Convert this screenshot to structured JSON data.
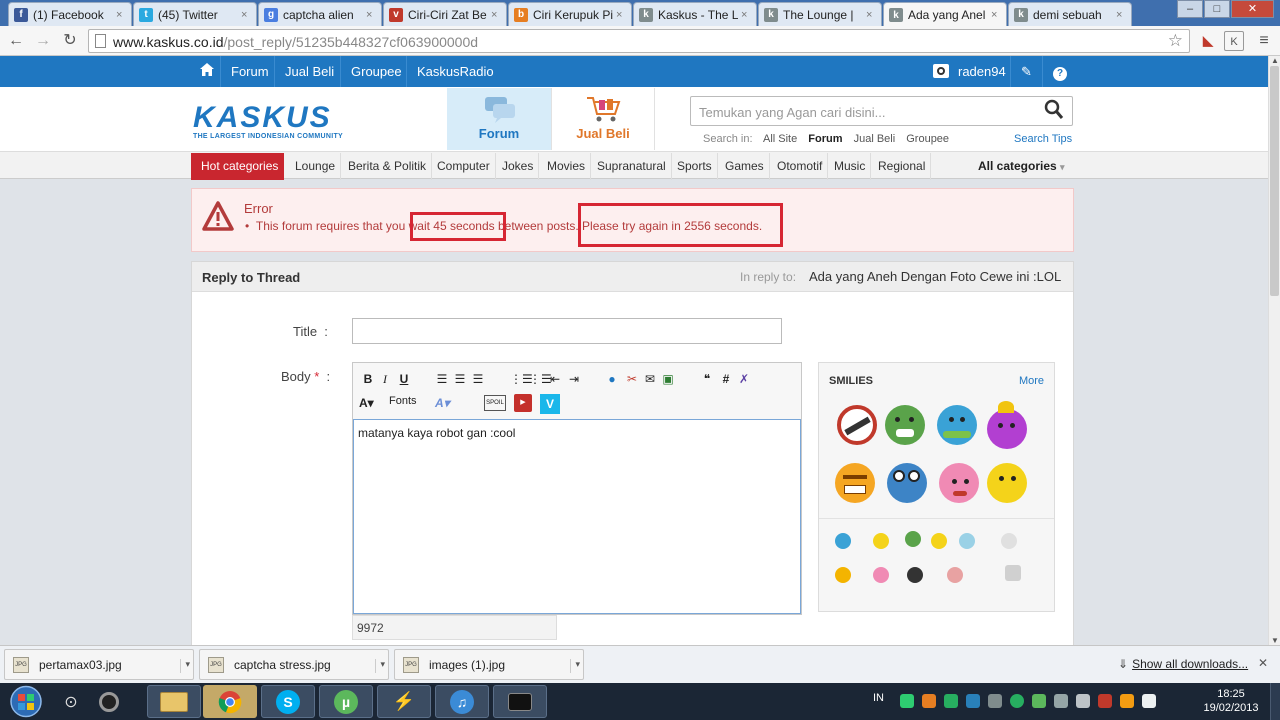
{
  "browser": {
    "tabs": [
      {
        "label": "(1) Facebook",
        "icon": "facebook-icon",
        "color": "#3b5998",
        "glyph": "f"
      },
      {
        "label": "(45) Twitter",
        "icon": "twitter-icon",
        "color": "#2aa9e0",
        "glyph": "t"
      },
      {
        "label": "captcha alien",
        "icon": "google-icon",
        "color": "#4a7ee0",
        "glyph": "g"
      },
      {
        "label": "Ciri-Ciri Zat Be",
        "icon": "shield-icon",
        "color": "#c0392b",
        "glyph": "v"
      },
      {
        "label": "Ciri Kerupuk Pi",
        "icon": "blog-icon",
        "color": "#e67e22",
        "glyph": "b"
      },
      {
        "label": "Kaskus - The L",
        "icon": "kaskus-icon",
        "color": "#7f8c8d",
        "glyph": "k"
      },
      {
        "label": "The Lounge |",
        "icon": "kaskus-icon",
        "color": "#7f8c8d",
        "glyph": "k"
      },
      {
        "label": "Ada yang Anel",
        "icon": "kaskus-icon",
        "color": "#7f8c8d",
        "glyph": "k",
        "active": true
      },
      {
        "label": "demi sebuah",
        "icon": "kaskus-icon",
        "color": "#7f8c8d",
        "glyph": "k"
      }
    ],
    "url_host": "www.kaskus.co.id",
    "url_path": "/post_reply/51235b448327cf063900000d"
  },
  "topnav": {
    "items": [
      "Forum",
      "Jual Beli",
      "Groupee",
      "KaskusRadio"
    ],
    "username": "raden94"
  },
  "header": {
    "logo_word": "KASKUS",
    "logo_tagline": "THE LARGEST INDONESIAN COMMUNITY",
    "forum_label": "Forum",
    "jualbeli_label": "Jual Beli",
    "search_placeholder": "Temukan yang Agan cari disini...",
    "search_in_label": "Search in:",
    "search_in_options": [
      "All Site",
      "Forum",
      "Jual Beli",
      "Groupee"
    ],
    "search_tips": "Search Tips"
  },
  "categories": {
    "hot": "Hot categories",
    "items": [
      "Lounge",
      "Berita & Politik",
      "Computer",
      "Jokes",
      "Movies",
      "Supranatural",
      "Sports",
      "Games",
      "Otomotif",
      "Music",
      "Regional"
    ],
    "all": "All categories"
  },
  "error": {
    "title": "Error",
    "message": "This forum requires that you wait 45 seconds between posts. Please try again in 2556 seconds.",
    "highlight_color": "#d62633"
  },
  "reply": {
    "panel_title": "Reply to Thread",
    "in_reply_label": "In reply to:",
    "thread_title": "Ada yang Aneh Dengan Foto Cewe ini :LOL",
    "title_label": "Title",
    "title_value": "",
    "body_label": "Body",
    "body_text": "matanya kaya robot gan :cool",
    "fonts_label": "Fonts",
    "counter": "9972",
    "smilies_title": "SMILIES",
    "smilies_more": "More"
  },
  "downloads": {
    "items": [
      "pertamax03.jpg",
      "captcha stress.jpg",
      "images (1).jpg"
    ],
    "show_all": "Show all downloads..."
  },
  "taskbar": {
    "lang": "IN",
    "time": "18:25",
    "date": "19/02/2013"
  }
}
